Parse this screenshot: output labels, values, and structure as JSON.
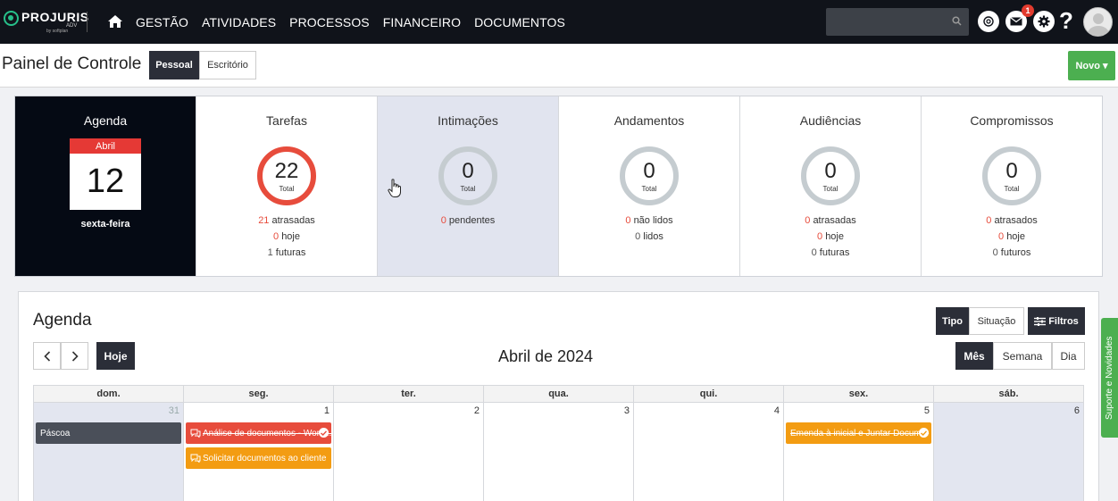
{
  "brand": {
    "name": "PROJURIS",
    "sub": "ADV",
    "by": "by softplan"
  },
  "nav": {
    "items": [
      "GESTÃO",
      "ATIVIDADES",
      "PROCESSOS",
      "FINANCEIRO",
      "DOCUMENTOS"
    ]
  },
  "header": {
    "notification_count": "1",
    "help": "?"
  },
  "titlebar": {
    "title": "Painel de Controle",
    "tab_pessoal": "Pessoal",
    "tab_escritorio": "Escritório",
    "novo_label": "Novo ▾"
  },
  "cards": {
    "agenda": {
      "title": "Agenda",
      "month": "Abril",
      "day": "12",
      "weekday": "sexta-feira"
    },
    "tarefas": {
      "title": "Tarefas",
      "total": "22",
      "total_label": "Total",
      "lines": [
        {
          "n": "21",
          "t": "atrasadas"
        },
        {
          "n": "0",
          "t": "hoje"
        },
        {
          "n": "1",
          "t": "futuras"
        }
      ]
    },
    "intimacoes": {
      "title": "Intimações",
      "total": "0",
      "total_label": "Total",
      "lines": [
        {
          "n": "0",
          "t": "pendentes"
        }
      ]
    },
    "andamentos": {
      "title": "Andamentos",
      "total": "0",
      "total_label": "Total",
      "lines": [
        {
          "n": "0",
          "t": "não lidos"
        },
        {
          "n": "0",
          "t": "lidos"
        }
      ]
    },
    "audiencias": {
      "title": "Audiências",
      "total": "0",
      "total_label": "Total",
      "lines": [
        {
          "n": "0",
          "t": "atrasadas"
        },
        {
          "n": "0",
          "t": "hoje"
        },
        {
          "n": "0",
          "t": "futuras"
        }
      ]
    },
    "compromissos": {
      "title": "Compromissos",
      "total": "0",
      "total_label": "Total",
      "lines": [
        {
          "n": "0",
          "t": "atrasados"
        },
        {
          "n": "0",
          "t": "hoje"
        },
        {
          "n": "0",
          "t": "futuros"
        }
      ]
    }
  },
  "agenda": {
    "title": "Agenda",
    "tipo": "Tipo",
    "situacao": "Situação",
    "filtros": "Filtros",
    "hoje": "Hoje",
    "month_title": "Abril de 2024",
    "view_mes": "Mês",
    "view_semana": "Semana",
    "view_dia": "Dia",
    "weekdays": [
      "dom.",
      "seg.",
      "ter.",
      "qua.",
      "qui.",
      "sex.",
      "sáb."
    ],
    "days": [
      "31",
      "1",
      "2",
      "3",
      "4",
      "5",
      "6"
    ],
    "events": {
      "pascoa": "Páscoa",
      "analise": "Análise de documentos - Work...",
      "solicitar": "Solicitar documentos ao cliente",
      "emenda": "Emenda à inicial e Juntar Docum..."
    }
  },
  "suporte": "Suporte e Novidades",
  "colors": {
    "accent_green": "#4caf50",
    "alert_red": "#e74c3c",
    "event_orange": "#f39c12",
    "dark": "#2b2e38"
  }
}
